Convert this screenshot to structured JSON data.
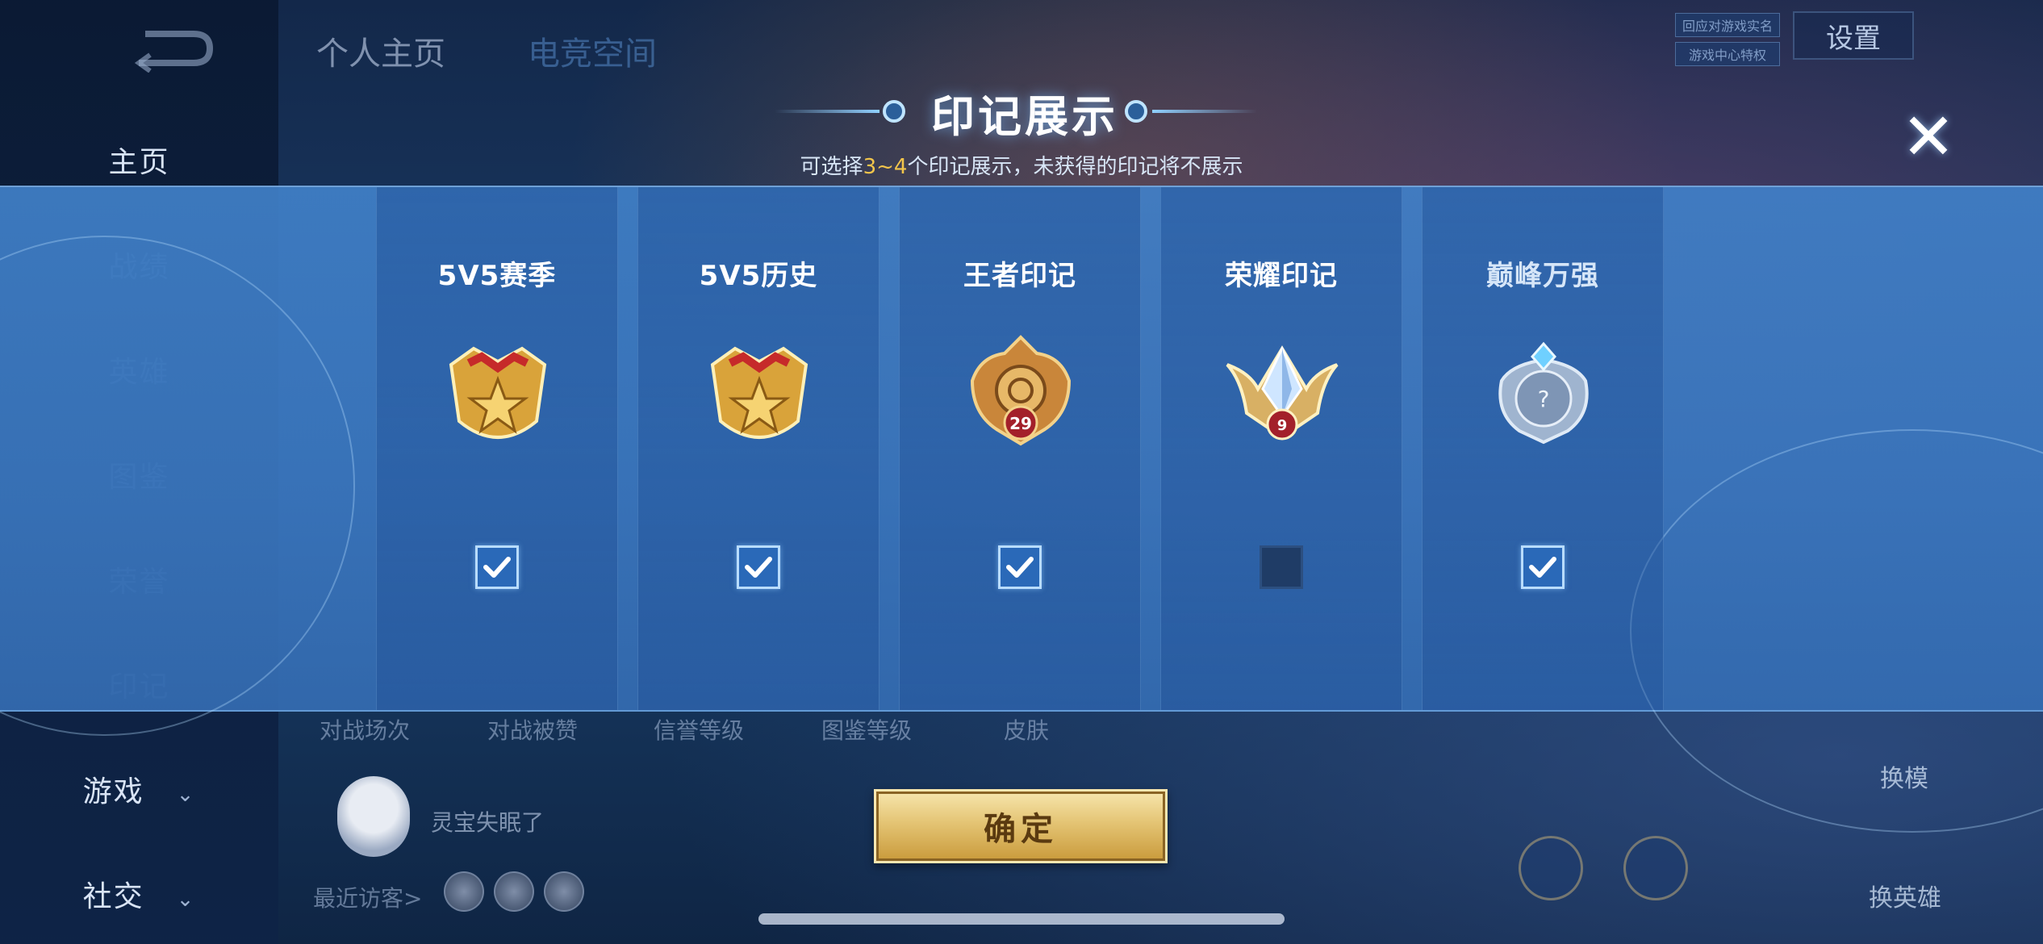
{
  "background": {
    "nav": {
      "home": "主页",
      "dimmed": [
        "战绩",
        "英雄",
        "图鉴",
        "荣誉",
        "印记"
      ],
      "game": "游戏",
      "social": "社交"
    },
    "tabs": [
      "个人主页",
      "电竞空间"
    ],
    "settings_label": "设置",
    "tiny_tags": [
      "回应对游戏实名",
      "游戏中心特权"
    ],
    "stats": [
      "对战场次",
      "对战被赞",
      "信誉等级",
      "图鉴等级",
      "皮肤"
    ],
    "avatar_name": "灵宝失眠了",
    "recent_visitors": "最近访客>",
    "right_labels": {
      "change_model": "换模",
      "change_hero": "换英雄"
    }
  },
  "modal": {
    "title": "印记展示",
    "subtitle_pre": "可选择",
    "subtitle_range": "3~4",
    "subtitle_post": "个印记展示，未获得的印记将不展示",
    "close_symbol": "✕",
    "cards": [
      {
        "title": "5V5赛季",
        "badge": "gold-star-crest",
        "checked": true
      },
      {
        "title": "5V5历史",
        "badge": "gold-star-crest",
        "checked": true
      },
      {
        "title": "王者印记",
        "badge": "king-emblem",
        "level": "29",
        "checked": true
      },
      {
        "title": "荣耀印记",
        "badge": "glory-emblem",
        "level": "9",
        "checked": false
      },
      {
        "title": "巅峰万强",
        "badge": "peak-locked-emblem",
        "badge_text": "?",
        "checked": true
      }
    ],
    "confirm_label": "确定"
  },
  "colors": {
    "accent_gold": "#f2c54b",
    "checkbox_on": "#2a69b8",
    "checkbox_off": "#1f3c66"
  }
}
